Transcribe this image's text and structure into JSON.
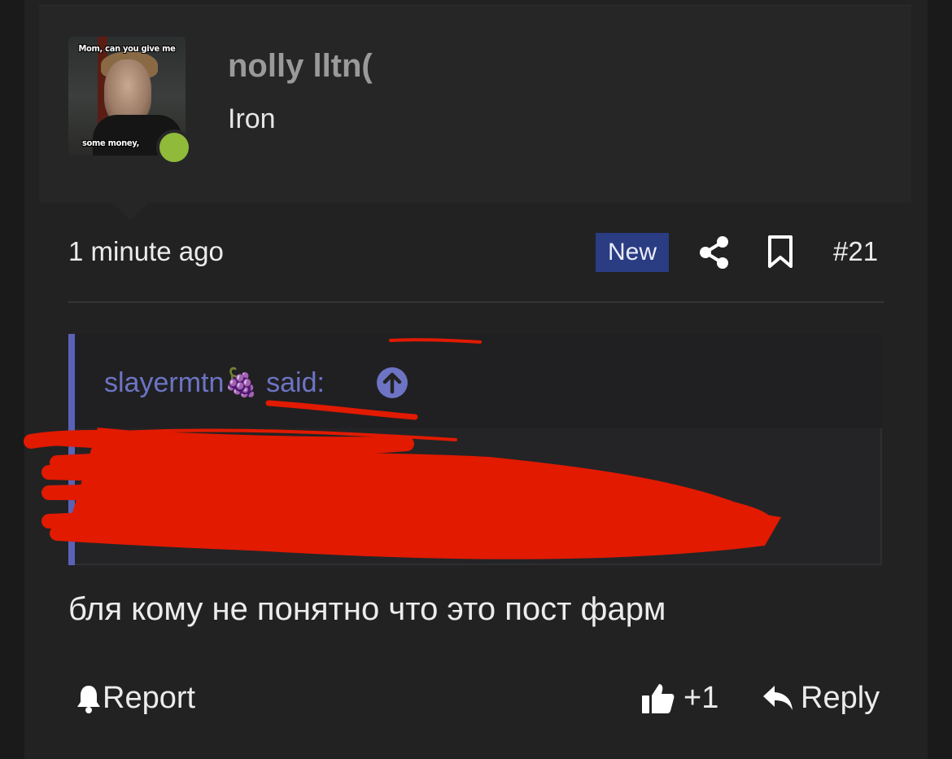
{
  "avatar": {
    "caption_top": "Mom, can you give me",
    "caption_bottom": "some money,",
    "status_color": "#8fba3a"
  },
  "user": {
    "name": "nolly lltn(",
    "title": "Iron"
  },
  "meta": {
    "time": "1 minute ago",
    "new_badge": "New",
    "post_number": "#21",
    "share_icon": "share-icon",
    "bookmark_icon": "bookmark-icon"
  },
  "quote": {
    "author": "slayermtn🍇 said:",
    "body": "",
    "expand_icon": "arrow-up-circle-icon",
    "accent_color": "#5a62b7",
    "redacted": true
  },
  "message": "бля кому не понятно что это пост фарм",
  "actions": {
    "report_label": "Report",
    "like_count": "+1",
    "reply_label": "Reply"
  },
  "colors": {
    "background": "#1a1a1a",
    "post_background": "#222223",
    "badge_background": "#2a3c82",
    "redaction": "#e11a00"
  }
}
